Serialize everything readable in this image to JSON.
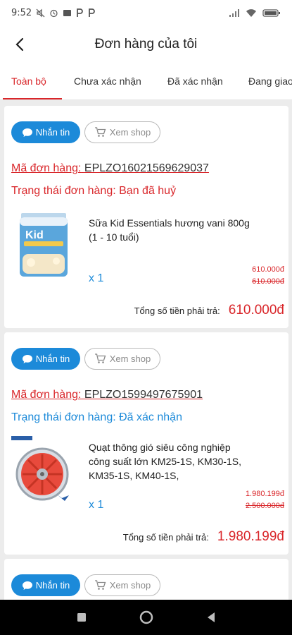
{
  "status_bar": {
    "time": "9:52",
    "icons": [
      "mute-icon",
      "alarm-icon",
      "notification-icon",
      "p-icon",
      "p-icon"
    ],
    "battery_icon": "battery-icon",
    "signal_icon": "signal-icon",
    "wifi_icon": "wifi-icon"
  },
  "header": {
    "title": "Đơn hàng của tôi",
    "back_icon": "back-arrow-icon"
  },
  "tabs": [
    {
      "label": "Toàn bộ",
      "active": true
    },
    {
      "label": "Chưa xác nhận",
      "active": false
    },
    {
      "label": "Đã xác nhận",
      "active": false
    },
    {
      "label": "Đang giao",
      "active": false
    }
  ],
  "buttons": {
    "chat_label": "Nhắn tin",
    "shop_label": "Xem shop"
  },
  "orders": [
    {
      "code_label": "Mã đơn hàng:",
      "code": "EPLZO16021569629037",
      "status_label": "Trạng thái đơn hàng:",
      "status": "Bạn đã huỷ",
      "status_color": "#d9262a",
      "product_name": "Sữa Kid Essentials hương vani 800g (1 - 10 tuổi)",
      "quantity": "x 1",
      "price_new": "610.000đ",
      "price_old": "610.000đ",
      "total_label": "Tổng số tiền phải trả:",
      "total": "610.000đ"
    },
    {
      "code_label": "Mã đơn hàng:",
      "code": "EPLZO1599497675901",
      "status_label": "Trạng thái đơn hàng:",
      "status": "Đã xác nhận",
      "status_color": "#1c8ad9",
      "product_name": "Quạt thông gió siêu công nghiệp công suất lớn KM25-1S, KM30-1S, KM35-1S, KM40-1S,",
      "quantity": "x 1",
      "price_new": "1.980.199đ",
      "price_old": "2.500.000đ",
      "total_label": "Tổng số tiền phải trả:",
      "total": "1.980.199đ"
    }
  ],
  "colors": {
    "accent_red": "#d9262a",
    "accent_blue": "#1c8ad9"
  }
}
